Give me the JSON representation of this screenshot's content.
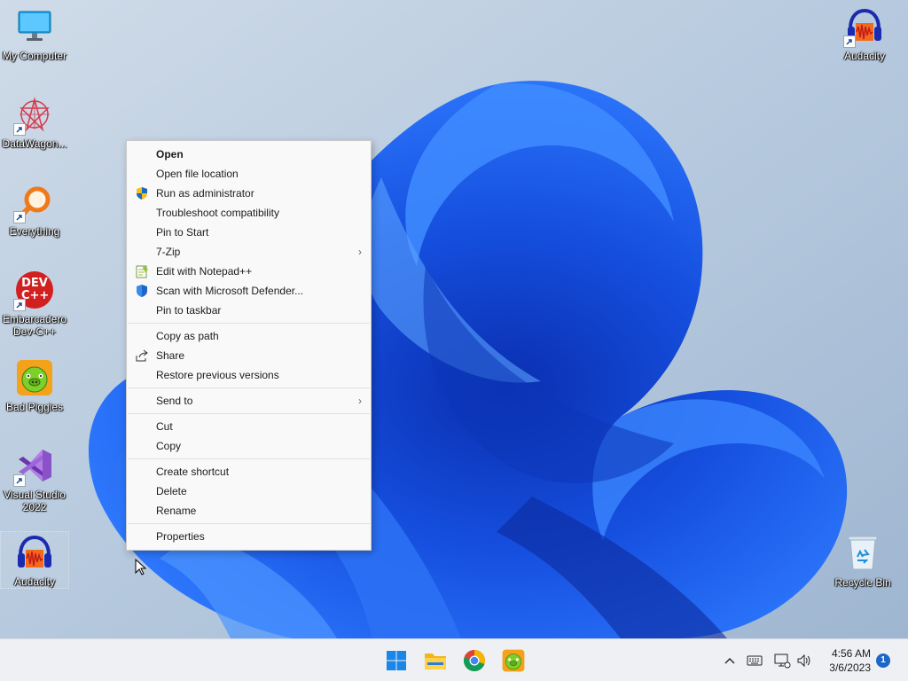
{
  "desktop": {
    "icons_left": [
      {
        "label": "My Computer"
      },
      {
        "label": "DataWagon..."
      },
      {
        "label": "Everything"
      },
      {
        "label": "Embarcadero Dev-C++"
      },
      {
        "label": "Bad Piggies"
      },
      {
        "label": "Visual Studio 2022"
      },
      {
        "label": "Audacity"
      }
    ],
    "icons_right": [
      {
        "label": "Audacity"
      },
      {
        "label": "Recycle Bin"
      }
    ],
    "devcpp_icon_text": "DEV C++"
  },
  "context_menu": {
    "items": [
      {
        "label": "Open"
      },
      {
        "label": "Open file location"
      },
      {
        "label": "Run as administrator"
      },
      {
        "label": "Troubleshoot compatibility"
      },
      {
        "label": "Pin to Start"
      },
      {
        "label": "7-Zip"
      },
      {
        "label": "Edit with Notepad++"
      },
      {
        "label": "Scan with Microsoft Defender..."
      },
      {
        "label": "Pin to taskbar"
      },
      {
        "label": "Copy as path"
      },
      {
        "label": "Share"
      },
      {
        "label": "Restore previous versions"
      },
      {
        "label": "Send to"
      },
      {
        "label": "Cut"
      },
      {
        "label": "Copy"
      },
      {
        "label": "Create shortcut"
      },
      {
        "label": "Delete"
      },
      {
        "label": "Rename"
      },
      {
        "label": "Properties"
      }
    ],
    "submenu_arrow": "›"
  },
  "taskbar": {
    "apps": [
      "start-icon",
      "file-explorer-icon",
      "chrome-icon",
      "bad-piggies-icon"
    ],
    "tray": [
      "chevron-up-icon",
      "keyboard-icon",
      "network-icon",
      "volume-icon"
    ],
    "clock": {
      "time": "4:56 AM",
      "date": "3/6/2023"
    },
    "notification_count": "1"
  },
  "colors": {
    "accent": "#1f66c9",
    "wallpaper_bg": "#b7c9dd",
    "bloom": "#1a5ee8",
    "menu_bg": "#f9f9f9",
    "taskbar_bg": "#eef0f3"
  }
}
